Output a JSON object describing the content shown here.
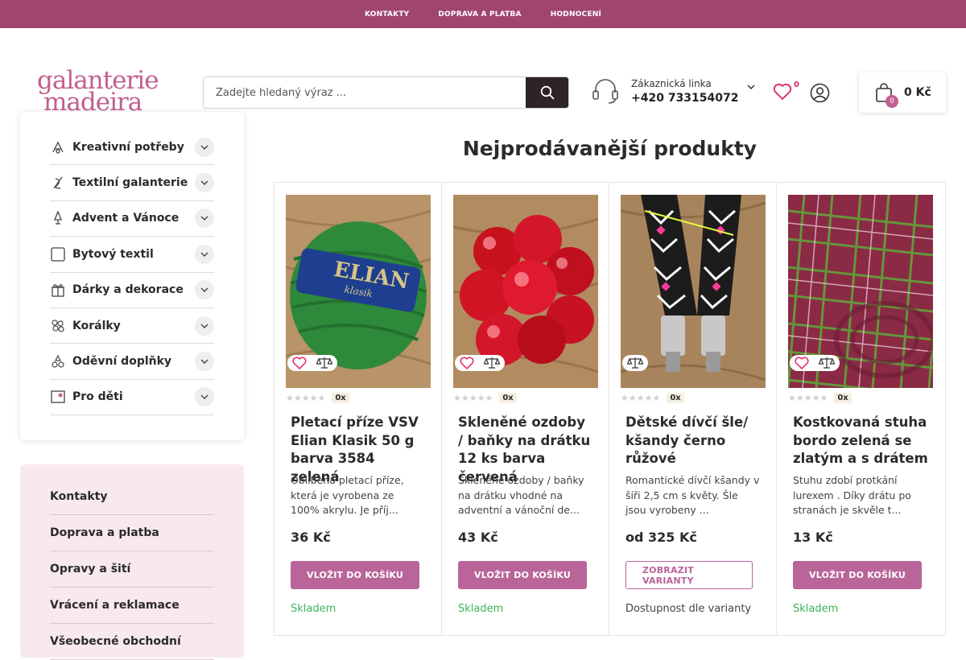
{
  "topbar": {
    "links": [
      "KONTAKTY",
      "DOPRAVA A PLATBA",
      "HODNOCENÍ"
    ]
  },
  "logo": {
    "line1": "galanterie",
    "line2": "madeira"
  },
  "search": {
    "placeholder": "Zadejte hledaný výraz ..."
  },
  "support": {
    "label": "Zákaznická linka",
    "phone": "+420 733154072"
  },
  "wishlist": {
    "count": "0"
  },
  "cart": {
    "count": "0",
    "total": "0 Kč"
  },
  "sidebar": {
    "categories": [
      {
        "label": "Kreativní potřeby",
        "icon": "craft-icon"
      },
      {
        "label": "Textilní galanterie",
        "icon": "thread-icon"
      },
      {
        "label": "Advent a Vánoce",
        "icon": "christmas-tree-icon"
      },
      {
        "label": "Bytový textil",
        "icon": "pillow-icon"
      },
      {
        "label": "Dárky a dekorace",
        "icon": "gift-icon"
      },
      {
        "label": "Korálky",
        "icon": "beads-icon"
      },
      {
        "label": "Oděvní doplňky",
        "icon": "accessory-icon"
      },
      {
        "label": "Pro děti",
        "icon": "kids-icon"
      }
    ]
  },
  "info_links": [
    "Kontakty",
    "Doprava a platba",
    "Opravy a šití",
    "Vrácení a reklamace",
    "Všeobecné obchodní"
  ],
  "section": {
    "title": "Nejprodávanější produkty"
  },
  "products": [
    {
      "title": "Pletací příze VSV Elian Klasik 50 g barva 3584 zelená",
      "desc": "Oblíbená pletací příze, která je vyrobena ze 100% akrylu. Je příj...",
      "rating_count": "0x",
      "price": "36 Kč",
      "button": "VLOŽIT DO KOŠÍKU",
      "stock": "Skladem",
      "image": "green-yarn"
    },
    {
      "title": "Skleněné ozdoby / baňky na drátku 12 ks barva červená",
      "desc": "Skleněné ozdoby / baňky na drátku vhodné na adventní a vánoční de...",
      "rating_count": "0x",
      "price": "43 Kč",
      "button": "VLOŽIT DO KOŠÍKU",
      "stock": "Skladem",
      "image": "red-baubles"
    },
    {
      "title": "Dětské dívčí šle/ kšandy černo růžové",
      "desc": "Romantické dívčí kšandy v šíři 2,5 cm s květy. Šle jsou vyrobeny ...",
      "rating_count": "0x",
      "price": "od 325 Kč",
      "button": "ZOBRAZIT VARIANTY",
      "stock": "Dostupnost dle varianty",
      "image": "suspenders"
    },
    {
      "title": "Kostkovaná stuha bordo zelená se zlatým a s drátem",
      "desc": "Stuhu zdobí protkání lurexem . Díky drátu po stranách je skvěle t...",
      "rating_count": "0x",
      "price": "13 Kč",
      "button": "VLOŽIT DO KOŠÍKU",
      "stock": "Skladem",
      "image": "plaid-ribbon"
    }
  ],
  "colors": {
    "brand": "#a0456f",
    "accent": "#b9659a",
    "logo": "#c0608e",
    "stock": "#3bb45a",
    "search_button": "#2d2329"
  }
}
